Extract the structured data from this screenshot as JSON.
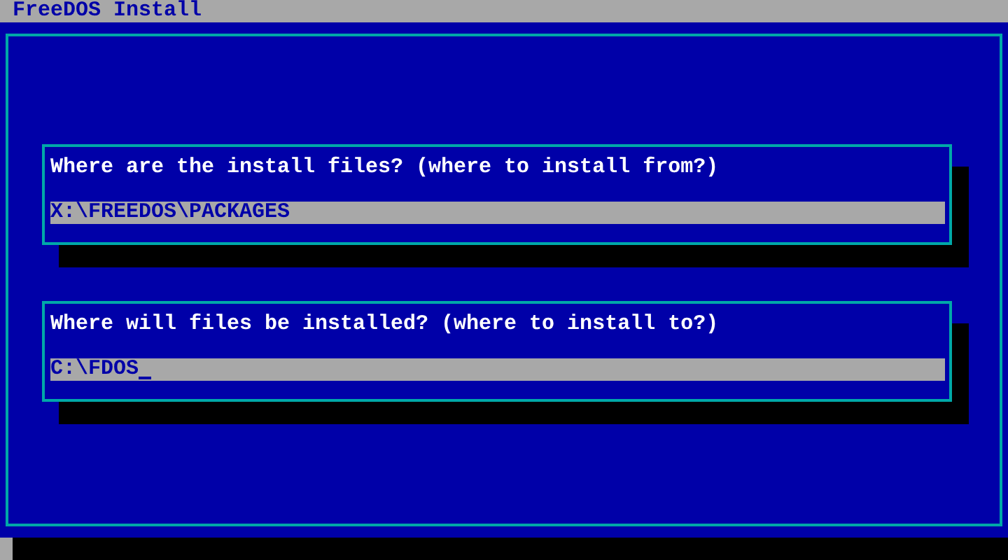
{
  "window": {
    "title": "FreeDOS Install"
  },
  "prompts": [
    {
      "question": "Where are the install files? (where to install from?)",
      "value": "X:\\FREEDOS\\PACKAGES",
      "focused": false
    },
    {
      "question": "Where will files be installed? (where to install to?)",
      "value": "C:\\FDOS",
      "focused": true
    }
  ]
}
